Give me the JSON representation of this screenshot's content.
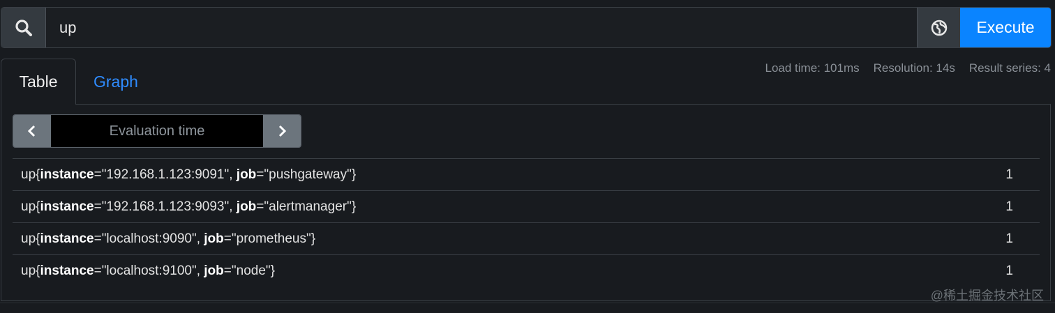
{
  "query": {
    "value": "up",
    "execute_label": "Execute"
  },
  "tabs": [
    {
      "label": "Table"
    },
    {
      "label": "Graph"
    }
  ],
  "stats": {
    "load_time": "Load time: 101ms",
    "resolution": "Resolution: 14s",
    "result_series": "Result series: 4"
  },
  "eval": {
    "placeholder": "Evaluation time"
  },
  "rows": [
    {
      "metric": "up",
      "instance_key": "instance",
      "instance_val": "=\"192.168.1.123:9091\", ",
      "job_key": "job",
      "job_val": "=\"pushgateway\"}",
      "value": "1"
    },
    {
      "metric": "up",
      "instance_key": "instance",
      "instance_val": "=\"192.168.1.123:9093\", ",
      "job_key": "job",
      "job_val": "=\"alertmanager\"}",
      "value": "1"
    },
    {
      "metric": "up",
      "instance_key": "instance",
      "instance_val": "=\"localhost:9090\", ",
      "job_key": "job",
      "job_val": "=\"prometheus\"}",
      "value": "1"
    },
    {
      "metric": "up",
      "instance_key": "instance",
      "instance_val": "=\"localhost:9100\", ",
      "job_key": "job",
      "job_val": "=\"node\"}",
      "value": "1"
    }
  ],
  "watermark": "@稀土掘金技术社区",
  "icons": {
    "search": "search-icon",
    "metrics": "globe-icon",
    "prev": "chevron-left-icon",
    "next": "chevron-right-icon"
  }
}
